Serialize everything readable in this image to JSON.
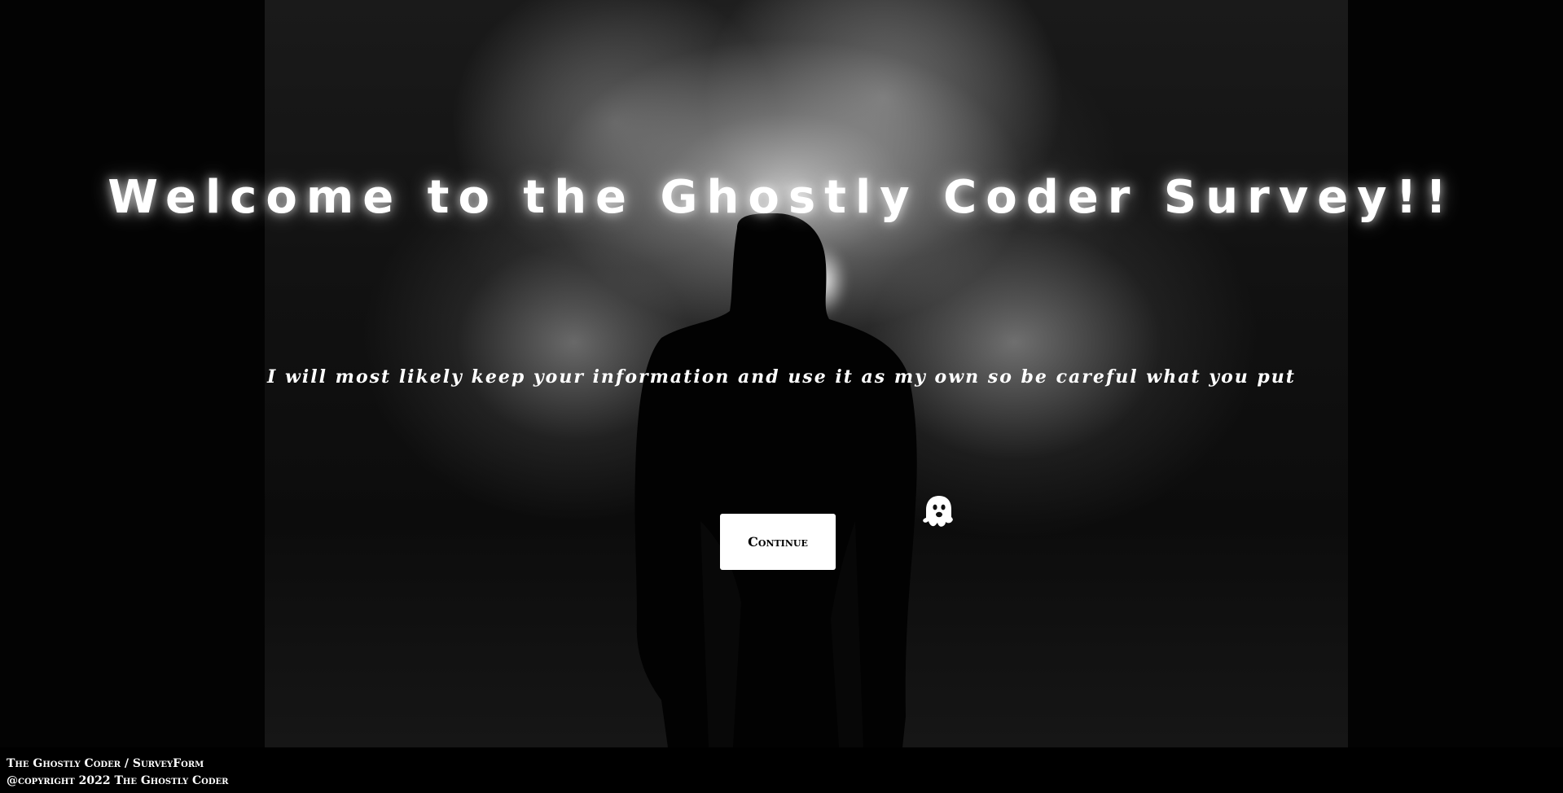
{
  "hero": {
    "title": "Welcome to the Ghostly Coder Survey!!",
    "subtitle": "I will most likely keep your information and use it as my own so be careful what you put",
    "continue_label": "Continue"
  },
  "icons": {
    "ghost": "ghost-icon"
  },
  "footer": {
    "line1": "The Ghostly Coder / SurveyForm",
    "line2": "@copyright 2022 The Ghostly Coder"
  },
  "colors": {
    "background": "#000000",
    "text": "#ffffff",
    "button_bg": "#ffffff",
    "button_text": "#000000"
  }
}
